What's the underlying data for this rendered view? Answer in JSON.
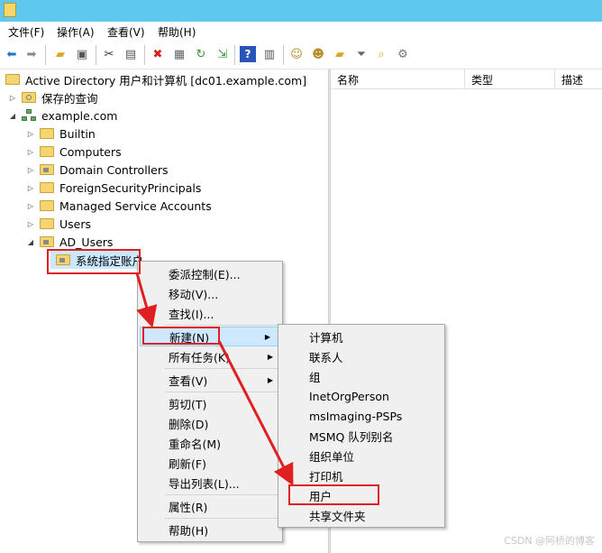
{
  "menubar": {
    "items": [
      "文件(F)",
      "操作(A)",
      "查看(V)",
      "帮助(H)"
    ]
  },
  "toolbar": {
    "icons": [
      "back-arrow-icon",
      "forward-arrow-icon",
      "up-folder-icon",
      "console-tree-icon",
      "cut-icon",
      "copy-icon",
      "delete-icon",
      "properties-icon",
      "refresh-icon",
      "export-icon",
      "help-icon",
      "view-icon",
      "add-user-icon",
      "add-group-icon",
      "new-ou-icon",
      "filter-icon",
      "find-icon",
      "delegate-icon"
    ]
  },
  "tree": {
    "root": "Active Directory 用户和计算机 [dc01.example.com]",
    "saved_queries": "保存的查询",
    "domain": "example.com",
    "children": [
      "Builtin",
      "Computers",
      "Domain Controllers",
      "ForeignSecurityPrincipals",
      "Managed Service Accounts",
      "Users",
      "AD_Users"
    ],
    "selected": "系统指定账户"
  },
  "columns": [
    "名称",
    "类型",
    "描述"
  ],
  "context_menu": {
    "items": [
      "委派控制(E)...",
      "移动(V)...",
      "查找(I)...",
      "新建(N)",
      "所有任务(K)",
      "查看(V)",
      "剪切(T)",
      "删除(D)",
      "重命名(M)",
      "刷新(F)",
      "导出列表(L)...",
      "属性(R)",
      "帮助(H)"
    ]
  },
  "submenu": {
    "items": [
      "计算机",
      "联系人",
      "组",
      "InetOrgPerson",
      "msImaging-PSPs",
      "MSMQ 队列别名",
      "组织单位",
      "打印机",
      "用户",
      "共享文件夹"
    ]
  },
  "watermark": "CSDN @阿桥的博客",
  "colors": {
    "titlebar": "#5ec8ee",
    "highlight": "#cde8ff",
    "annotation_red": "#e02020"
  }
}
